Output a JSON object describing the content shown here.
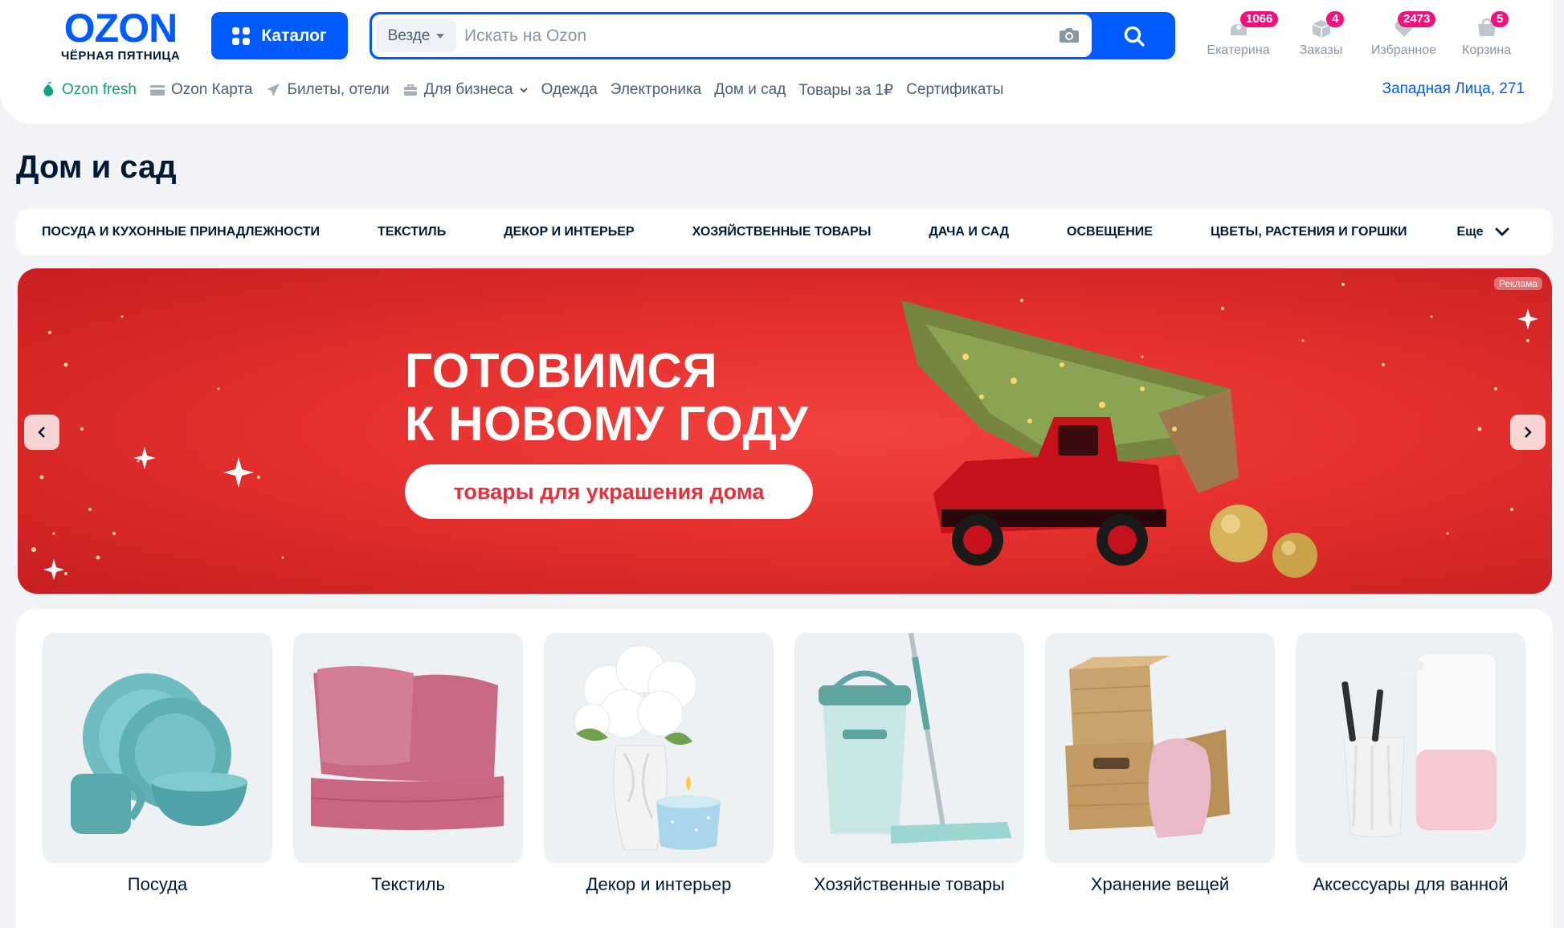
{
  "header": {
    "logo": {
      "word": "OZON",
      "subtitle": "ЧЁРНАЯ ПЯТНИЦА"
    },
    "catalog_label": "Каталог",
    "search": {
      "scope": "Везде",
      "placeholder": "Искать на Ozon"
    },
    "actions": [
      {
        "label": "Екатерина",
        "badge": "1066",
        "icon": "user-icon"
      },
      {
        "label": "Заказы",
        "badge": "4",
        "icon": "box-icon"
      },
      {
        "label": "Избранное",
        "badge": "2473",
        "icon": "heart-icon"
      },
      {
        "label": "Корзина",
        "badge": "5",
        "icon": "cart-icon"
      }
    ],
    "nav": [
      {
        "label": "Ozon fresh",
        "icon": "fresh-icon"
      },
      {
        "label": "Ozon Карта",
        "icon": "card-icon"
      },
      {
        "label": "Билеты, отели",
        "icon": "plane-icon"
      },
      {
        "label": "Для бизнеса",
        "icon": "briefcase-icon"
      },
      {
        "label": "Одежда"
      },
      {
        "label": "Электроника"
      },
      {
        "label": "Дом и сад"
      },
      {
        "label": "Товары за 1₽"
      },
      {
        "label": "Сертификаты"
      }
    ],
    "address": "Западная Лица, 271"
  },
  "page_title": "Дом и сад",
  "categories": [
    "Посуда и кухонные принадлежности",
    "Текстиль",
    "Декор и интерьер",
    "Хозяйственные товары",
    "Дача и сад",
    "Освещение",
    "Цветы, растения и горшки"
  ],
  "categories_more": "Еще",
  "banner": {
    "line1": "ГОТОВИМСЯ",
    "line2": "К НОВОМУ ГОДУ",
    "pill": "товары для украшения дома",
    "ad_tag": "Реклама"
  },
  "tiles": [
    {
      "label": "Посуда",
      "icon": "dishes-image"
    },
    {
      "label": "Текстиль",
      "icon": "pillows-image"
    },
    {
      "label": "Декор и интерьер",
      "icon": "vase-image"
    },
    {
      "label": "Хозяйственные товары",
      "icon": "mop-image"
    },
    {
      "label": "Хранение вещей",
      "icon": "baskets-image"
    },
    {
      "label": "Аксессуары для ванной",
      "icon": "bath-accessories-image"
    }
  ],
  "colors": {
    "brand": "#005bff",
    "badge": "#f1117e",
    "banner": "#e5302e",
    "fresh": "#10a37f"
  }
}
